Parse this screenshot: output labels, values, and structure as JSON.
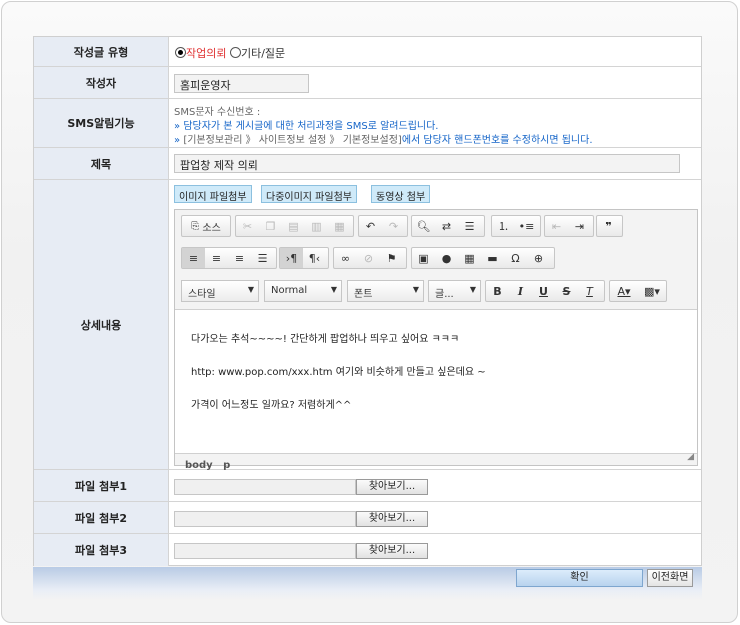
{
  "form": {
    "post_type": {
      "label": "작성글 유형",
      "options": [
        {
          "label": "작업의뢰",
          "selected": true,
          "color": "#e03030"
        },
        {
          "label": "기타/질문",
          "selected": false
        }
      ]
    },
    "author": {
      "label": "작성자",
      "value": "홈피운영자"
    },
    "sms": {
      "label": "SMS알림기능",
      "receive_label": "SMS문자 수신번호 :",
      "notice1_prefix": "»",
      "notice1": "담당자가 본 게시글에 대한 처리과정을 SMS로 알려드립니다.",
      "notice2_prefix": "»",
      "notice2_gray": "[기본정보관리 》 사이트정보 설정 》 기본정보설정]",
      "notice2_blue": "에서 담당자 핸드폰번호를 수정하시면 됩니다."
    },
    "title": {
      "label": "제목",
      "value": "팝업창 제작 의뢰"
    },
    "detail": {
      "label": "상세내용",
      "attach_buttons": [
        "이미지 파일첨부",
        "다중이미지 파일첨부",
        "동영상 첨부"
      ],
      "toolbar": {
        "source_label": "소스",
        "style_combo": "스타일",
        "format_combo": "Normal",
        "font_combo": "폰트",
        "size_combo": "글..."
      },
      "content_lines": [
        "다가오는 추석~~~~! 간단하게 팝업하나 띄우고 싶어요 ㅋㅋㅋ",
        "http: www.pop.com/xxx.htm  여기와 비슷하게 만들고 싶은데요 ~",
        "가격이 어느정도 일까요? 저렴하게^^"
      ],
      "status_path": "body   p"
    },
    "files": [
      {
        "label": "파일 첨부1",
        "button": "찾아보기..."
      },
      {
        "label": "파일 첨부2",
        "button": "찾아보기..."
      },
      {
        "label": "파일 첨부3",
        "button": "찾아보기..."
      }
    ]
  },
  "actions": {
    "confirm": "확인",
    "back": "이전화면"
  }
}
